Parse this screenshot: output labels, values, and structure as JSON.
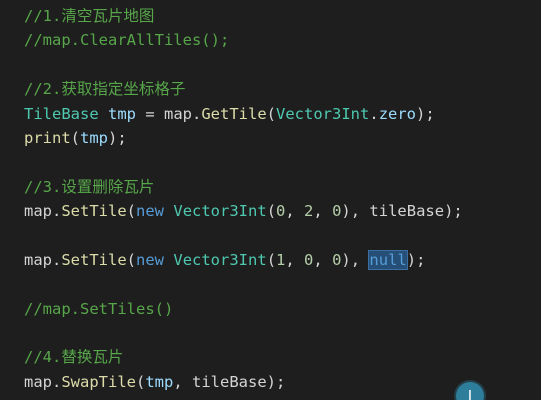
{
  "colors": {
    "background": "#1e1e1e",
    "comment": "#57a64a",
    "type": "#4ec9b0",
    "variable": "#9cdcfe",
    "method": "#dcdcaa",
    "keyword": "#569cd6",
    "number": "#b5cea8",
    "plain": "#d4d4d4",
    "selection": "#264f78",
    "badge": "#2e7d9a"
  },
  "code": {
    "l1": {
      "comment": "//1.清空瓦片地图"
    },
    "l2": {
      "comment": "//map.ClearAllTiles();"
    },
    "l4": {
      "comment": "//2.获取指定坐标格子"
    },
    "l5": {
      "type": "TileBase",
      "sp1": " ",
      "var1": "tmp",
      "eq": " = ",
      "obj": "map",
      "dot": ".",
      "method": "GetTile",
      "open": "(",
      "type2": "Vector3Int",
      "dot2": ".",
      "member": "zero",
      "close": ");"
    },
    "l6": {
      "method": "print",
      "open": "(",
      "var": "tmp",
      "close": ");"
    },
    "l8": {
      "comment": "//3.设置删除瓦片"
    },
    "l9": {
      "obj": "map",
      "dot": ".",
      "method": "SetTile",
      "open": "(",
      "kw": "new",
      "sp": " ",
      "type": "Vector3Int",
      "args_open": "(",
      "n1": "0",
      "c1": ", ",
      "n2": "2",
      "c2": ", ",
      "n3": "0",
      "args_close": "), ",
      "var": "tileBase",
      "close": ");"
    },
    "l11": {
      "obj": "map",
      "dot": ".",
      "method": "SetTile",
      "open": "(",
      "kw": "new",
      "sp": " ",
      "type": "Vector3Int",
      "args_open": "(",
      "n1": "1",
      "c1": ", ",
      "n2": "0",
      "c2": ", ",
      "n3": "0",
      "args_close": "), ",
      "kw_null": "null",
      "close": ");"
    },
    "l13": {
      "comment": "//map.SetTiles()"
    },
    "l15": {
      "comment": "//4.替换瓦片"
    },
    "l16": {
      "obj": "map",
      "dot": ".",
      "method": "SwapTile",
      "open": "(",
      "var1": "tmp",
      "comma": ", ",
      "var2": "tileBase",
      "close": ");"
    }
  },
  "badge": {
    "icon": "text-cursor-icon",
    "glyph": "I"
  }
}
